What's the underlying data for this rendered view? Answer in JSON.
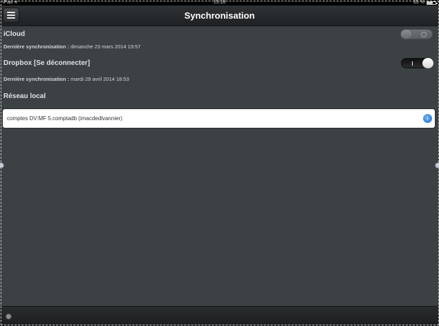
{
  "status": {
    "carrier": "iPad",
    "wifi_icon": "wifi-icon",
    "time": "13:18",
    "battery": "65 %",
    "battery_level": 0.65
  },
  "nav": {
    "title": "Synchronisation",
    "menu_icon": "hamburger-menu-icon"
  },
  "icloud": {
    "title": "iCloud",
    "last_sync_label": "Dernière synchronisation :",
    "last_sync_value": "dimanche 23 mars 2014 19:57",
    "enabled": false
  },
  "dropbox": {
    "title": "Dropbox  [Se déconnecter]",
    "last_sync_label": "Dernière synchronisation :",
    "last_sync_value": "mardi 29 avril 2014 18:53",
    "enabled": true
  },
  "local_network": {
    "title": "Réseau local",
    "items": [
      {
        "label": "comptes DV:MF 5.comptadb (imacdedlvannier)"
      }
    ]
  },
  "bottom": {
    "settings_icon": "gear-icon"
  }
}
